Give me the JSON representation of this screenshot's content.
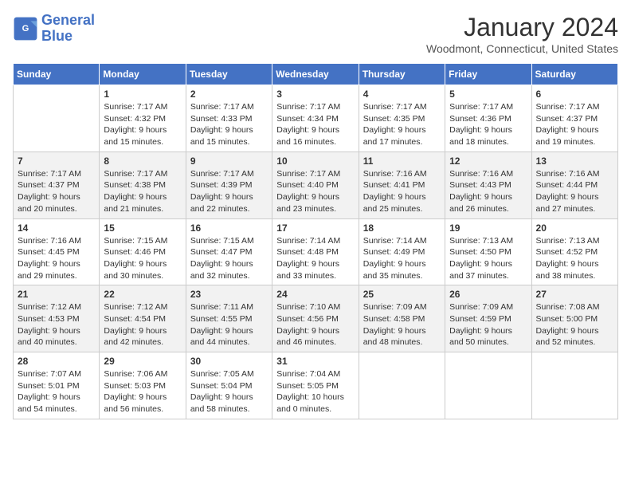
{
  "logo": {
    "line1": "General",
    "line2": "Blue"
  },
  "title": "January 2024",
  "location": "Woodmont, Connecticut, United States",
  "days_of_week": [
    "Sunday",
    "Monday",
    "Tuesday",
    "Wednesday",
    "Thursday",
    "Friday",
    "Saturday"
  ],
  "weeks": [
    [
      {
        "day": "",
        "sunrise": "",
        "sunset": "",
        "daylight": ""
      },
      {
        "day": "1",
        "sunrise": "Sunrise: 7:17 AM",
        "sunset": "Sunset: 4:32 PM",
        "daylight": "Daylight: 9 hours and 15 minutes."
      },
      {
        "day": "2",
        "sunrise": "Sunrise: 7:17 AM",
        "sunset": "Sunset: 4:33 PM",
        "daylight": "Daylight: 9 hours and 15 minutes."
      },
      {
        "day": "3",
        "sunrise": "Sunrise: 7:17 AM",
        "sunset": "Sunset: 4:34 PM",
        "daylight": "Daylight: 9 hours and 16 minutes."
      },
      {
        "day": "4",
        "sunrise": "Sunrise: 7:17 AM",
        "sunset": "Sunset: 4:35 PM",
        "daylight": "Daylight: 9 hours and 17 minutes."
      },
      {
        "day": "5",
        "sunrise": "Sunrise: 7:17 AM",
        "sunset": "Sunset: 4:36 PM",
        "daylight": "Daylight: 9 hours and 18 minutes."
      },
      {
        "day": "6",
        "sunrise": "Sunrise: 7:17 AM",
        "sunset": "Sunset: 4:37 PM",
        "daylight": "Daylight: 9 hours and 19 minutes."
      }
    ],
    [
      {
        "day": "7",
        "sunrise": "Sunrise: 7:17 AM",
        "sunset": "Sunset: 4:37 PM",
        "daylight": "Daylight: 9 hours and 20 minutes."
      },
      {
        "day": "8",
        "sunrise": "Sunrise: 7:17 AM",
        "sunset": "Sunset: 4:38 PM",
        "daylight": "Daylight: 9 hours and 21 minutes."
      },
      {
        "day": "9",
        "sunrise": "Sunrise: 7:17 AM",
        "sunset": "Sunset: 4:39 PM",
        "daylight": "Daylight: 9 hours and 22 minutes."
      },
      {
        "day": "10",
        "sunrise": "Sunrise: 7:17 AM",
        "sunset": "Sunset: 4:40 PM",
        "daylight": "Daylight: 9 hours and 23 minutes."
      },
      {
        "day": "11",
        "sunrise": "Sunrise: 7:16 AM",
        "sunset": "Sunset: 4:41 PM",
        "daylight": "Daylight: 9 hours and 25 minutes."
      },
      {
        "day": "12",
        "sunrise": "Sunrise: 7:16 AM",
        "sunset": "Sunset: 4:43 PM",
        "daylight": "Daylight: 9 hours and 26 minutes."
      },
      {
        "day": "13",
        "sunrise": "Sunrise: 7:16 AM",
        "sunset": "Sunset: 4:44 PM",
        "daylight": "Daylight: 9 hours and 27 minutes."
      }
    ],
    [
      {
        "day": "14",
        "sunrise": "Sunrise: 7:16 AM",
        "sunset": "Sunset: 4:45 PM",
        "daylight": "Daylight: 9 hours and 29 minutes."
      },
      {
        "day": "15",
        "sunrise": "Sunrise: 7:15 AM",
        "sunset": "Sunset: 4:46 PM",
        "daylight": "Daylight: 9 hours and 30 minutes."
      },
      {
        "day": "16",
        "sunrise": "Sunrise: 7:15 AM",
        "sunset": "Sunset: 4:47 PM",
        "daylight": "Daylight: 9 hours and 32 minutes."
      },
      {
        "day": "17",
        "sunrise": "Sunrise: 7:14 AM",
        "sunset": "Sunset: 4:48 PM",
        "daylight": "Daylight: 9 hours and 33 minutes."
      },
      {
        "day": "18",
        "sunrise": "Sunrise: 7:14 AM",
        "sunset": "Sunset: 4:49 PM",
        "daylight": "Daylight: 9 hours and 35 minutes."
      },
      {
        "day": "19",
        "sunrise": "Sunrise: 7:13 AM",
        "sunset": "Sunset: 4:50 PM",
        "daylight": "Daylight: 9 hours and 37 minutes."
      },
      {
        "day": "20",
        "sunrise": "Sunrise: 7:13 AM",
        "sunset": "Sunset: 4:52 PM",
        "daylight": "Daylight: 9 hours and 38 minutes."
      }
    ],
    [
      {
        "day": "21",
        "sunrise": "Sunrise: 7:12 AM",
        "sunset": "Sunset: 4:53 PM",
        "daylight": "Daylight: 9 hours and 40 minutes."
      },
      {
        "day": "22",
        "sunrise": "Sunrise: 7:12 AM",
        "sunset": "Sunset: 4:54 PM",
        "daylight": "Daylight: 9 hours and 42 minutes."
      },
      {
        "day": "23",
        "sunrise": "Sunrise: 7:11 AM",
        "sunset": "Sunset: 4:55 PM",
        "daylight": "Daylight: 9 hours and 44 minutes."
      },
      {
        "day": "24",
        "sunrise": "Sunrise: 7:10 AM",
        "sunset": "Sunset: 4:56 PM",
        "daylight": "Daylight: 9 hours and 46 minutes."
      },
      {
        "day": "25",
        "sunrise": "Sunrise: 7:09 AM",
        "sunset": "Sunset: 4:58 PM",
        "daylight": "Daylight: 9 hours and 48 minutes."
      },
      {
        "day": "26",
        "sunrise": "Sunrise: 7:09 AM",
        "sunset": "Sunset: 4:59 PM",
        "daylight": "Daylight: 9 hours and 50 minutes."
      },
      {
        "day": "27",
        "sunrise": "Sunrise: 7:08 AM",
        "sunset": "Sunset: 5:00 PM",
        "daylight": "Daylight: 9 hours and 52 minutes."
      }
    ],
    [
      {
        "day": "28",
        "sunrise": "Sunrise: 7:07 AM",
        "sunset": "Sunset: 5:01 PM",
        "daylight": "Daylight: 9 hours and 54 minutes."
      },
      {
        "day": "29",
        "sunrise": "Sunrise: 7:06 AM",
        "sunset": "Sunset: 5:03 PM",
        "daylight": "Daylight: 9 hours and 56 minutes."
      },
      {
        "day": "30",
        "sunrise": "Sunrise: 7:05 AM",
        "sunset": "Sunset: 5:04 PM",
        "daylight": "Daylight: 9 hours and 58 minutes."
      },
      {
        "day": "31",
        "sunrise": "Sunrise: 7:04 AM",
        "sunset": "Sunset: 5:05 PM",
        "daylight": "Daylight: 10 hours and 0 minutes."
      },
      {
        "day": "",
        "sunrise": "",
        "sunset": "",
        "daylight": ""
      },
      {
        "day": "",
        "sunrise": "",
        "sunset": "",
        "daylight": ""
      },
      {
        "day": "",
        "sunrise": "",
        "sunset": "",
        "daylight": ""
      }
    ]
  ]
}
